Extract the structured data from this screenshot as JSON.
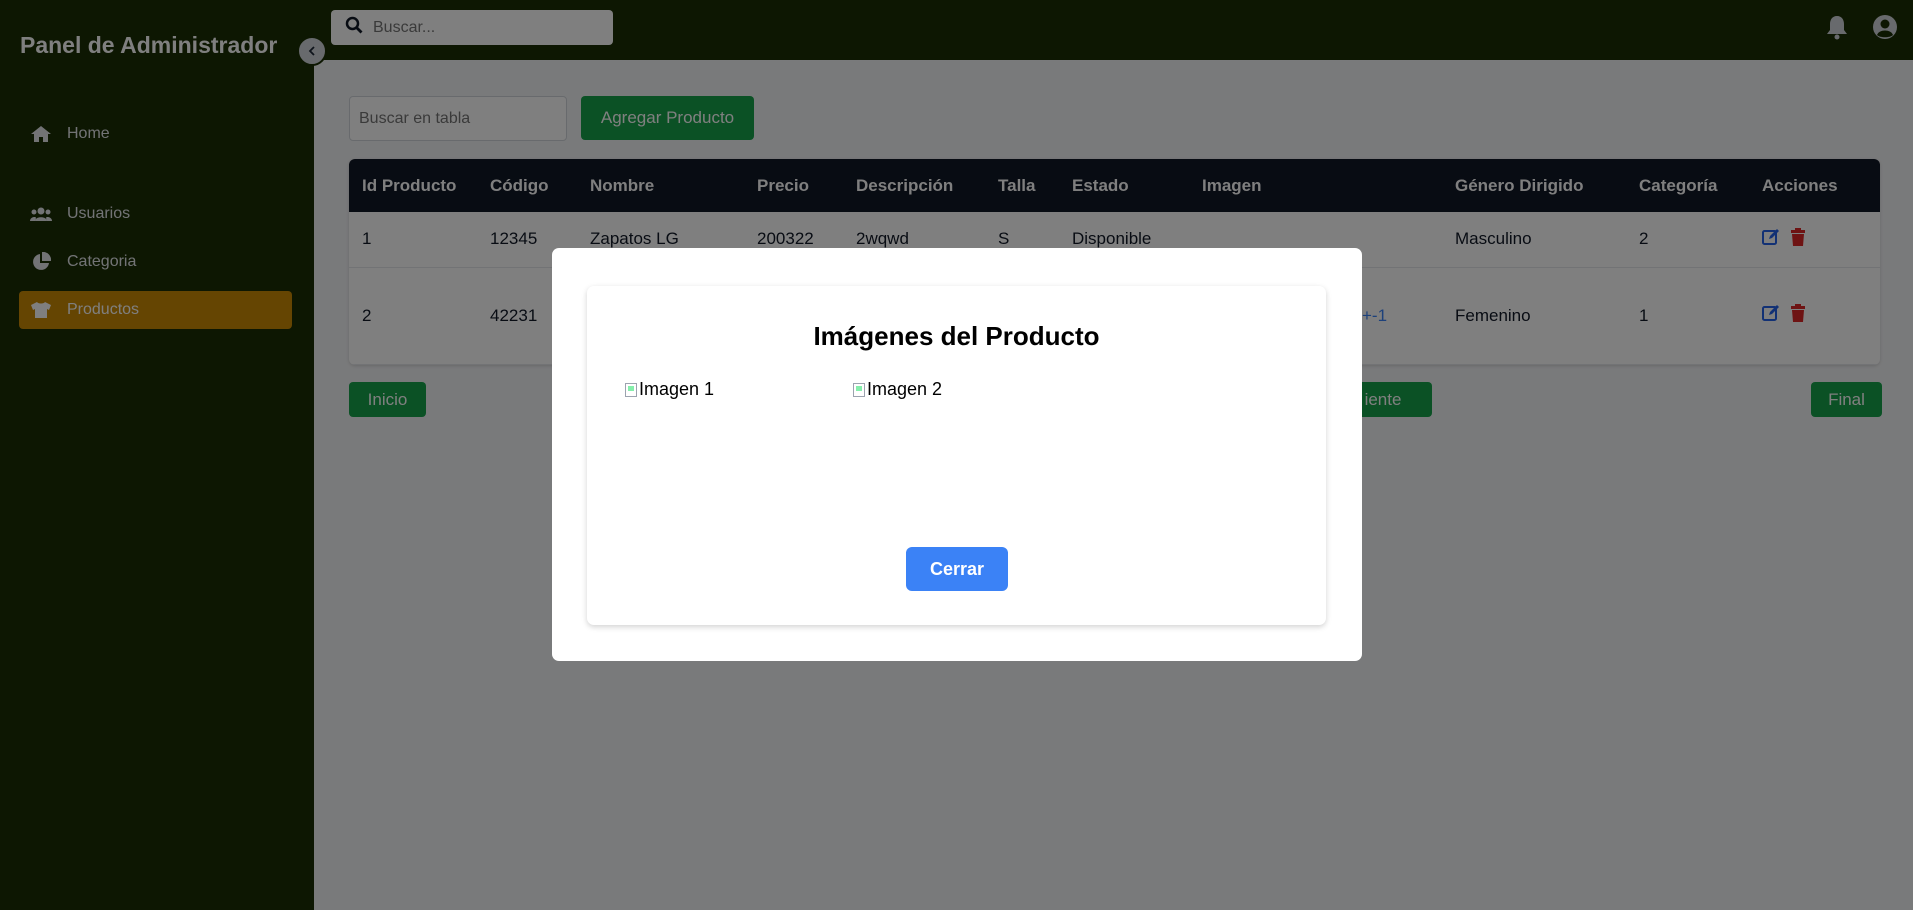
{
  "sidebar": {
    "brand": "Panel de Administrador",
    "items": [
      {
        "label": "Home",
        "icon": "home-icon"
      },
      {
        "label": "Usuarios",
        "icon": "users-icon"
      },
      {
        "label": "Categoria",
        "icon": "pie-chart-icon"
      },
      {
        "label": "Productos",
        "icon": "shirt-icon",
        "active": true
      }
    ]
  },
  "topbar": {
    "search_placeholder": "Buscar..."
  },
  "main": {
    "table_search_placeholder": "Buscar en tabla",
    "add_button": "Agregar Producto",
    "columns": [
      "Id Producto",
      "Código",
      "Nombre",
      "Precio",
      "Descripción",
      "Talla",
      "Estado",
      "Imagen",
      "Género Dirigido",
      "Categoría",
      "Acciones"
    ],
    "rows": [
      {
        "id": "1",
        "codigo": "12345",
        "nombre": "Zapatos LG",
        "precio": "200322",
        "descripcion": "2wqwd",
        "talla": "S",
        "estado": "Disponible",
        "imagen": "",
        "genero": "Masculino",
        "categoria": "2"
      },
      {
        "id": "2",
        "codigo": "42231",
        "nombre": "",
        "precio": "",
        "descripcion": "",
        "talla": "",
        "estado": "",
        "imagen": "+-1",
        "genero": "Femenino",
        "categoria": "1"
      }
    ],
    "pagination": {
      "start": "Inicio",
      "next": "iente",
      "end": "Final"
    }
  },
  "modal": {
    "title": "Imágenes del Producto",
    "images": [
      {
        "alt": "Imagen 1"
      },
      {
        "alt": "Imagen 2"
      }
    ],
    "close_button": "Cerrar"
  },
  "colors": {
    "sidebar_bg": "#1a2e05",
    "active_item": "#ca8a04",
    "primary_green": "#16a34a",
    "primary_blue": "#3b82f6",
    "table_header": "#111827"
  }
}
